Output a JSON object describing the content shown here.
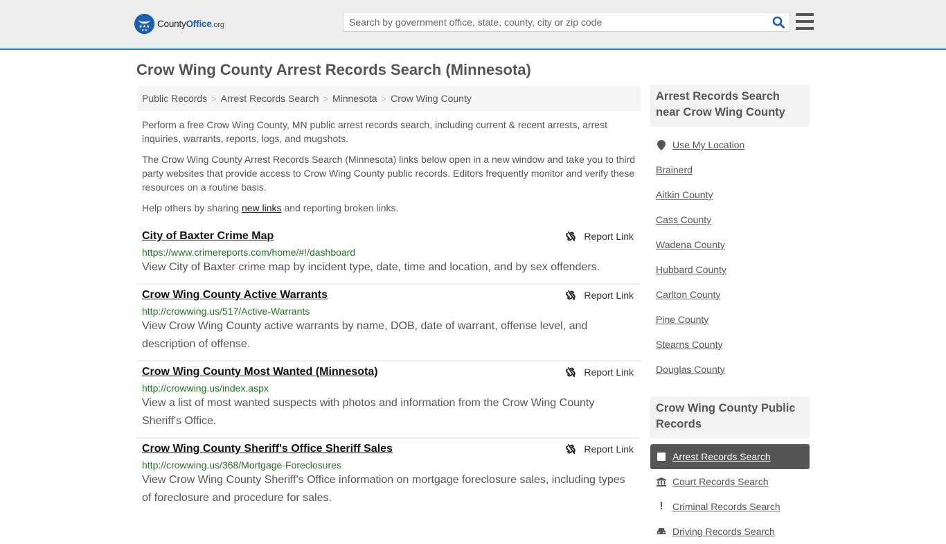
{
  "header": {
    "logo": {
      "name": "County",
      "name_bold": "Office",
      "tld": ".org"
    },
    "search": {
      "placeholder": "Search by government office, state, county, city or zip code",
      "value": ""
    },
    "colors": {
      "accent": "#337ab7",
      "brand": "#1f5ea8"
    }
  },
  "page": {
    "title": "Crow Wing County Arrest Records Search (Minnesota)",
    "breadcrumb": [
      "Public Records",
      "Arrest Records Search",
      "Minnesota",
      "Crow Wing County"
    ],
    "intro": {
      "p1": "Perform a free Crow Wing County, MN public arrest records search, including current & recent arrests, arrest inquiries, warrants, reports, logs, and mugshots.",
      "p2": "The Crow Wing County Arrest Records Search (Minnesota) links below open in a new window and take you to third party websites that provide access to Crow Wing County public records. Editors frequently monitor and verify these resources on a routine basis.",
      "p3_before": "Help others by sharing ",
      "p3_link": "new links",
      "p3_after": " and reporting broken links."
    }
  },
  "results": [
    {
      "title": "City of Baxter Crime Map",
      "url": "https://www.crimereports.com/home/#!/dashboard",
      "description": "View City of Baxter crime map by incident type, date, time and location, and by sex offenders.",
      "report_label": "Report Link"
    },
    {
      "title": "Crow Wing County Active Warrants",
      "url": "http://crowwing.us/517/Active-Warrants",
      "description": "View Crow Wing County active warrants by name, DOB, date of warrant, offense level, and description of offense.",
      "report_label": "Report Link"
    },
    {
      "title": "Crow Wing County Most Wanted (Minnesota)",
      "url": "http://crowwing.us/index.aspx",
      "description": "View a list of most wanted suspects with photos and information from the Crow Wing County Sheriff's Office.",
      "report_label": "Report Link"
    },
    {
      "title": "Crow Wing County Sheriff's Office Sheriff Sales",
      "url": "http://crowwing.us/368/Mortgage-Foreclosures",
      "description": "View Crow Wing County Sheriff's Office information on mortgage foreclosure sales, including types of foreclosure and procedure for sales.",
      "report_label": "Report Link"
    }
  ],
  "sidebar": {
    "nearby": {
      "heading": "Arrest Records Search near Crow Wing County",
      "use_location": "Use My Location",
      "items": [
        "Brainerd",
        "Aitkin County",
        "Cass County",
        "Wadena County",
        "Hubbard County",
        "Carlton County",
        "Pine County",
        "Stearns County",
        "Douglas County"
      ]
    },
    "public_records": {
      "heading": "Crow Wing County Public Records",
      "items": [
        {
          "label": "Arrest Records Search",
          "icon": "square-icon",
          "active": true
        },
        {
          "label": "Court Records Search",
          "icon": "courthouse-icon",
          "active": false
        },
        {
          "label": "Criminal Records Search",
          "icon": "exclamation-icon",
          "active": false
        },
        {
          "label": "Driving Records Search",
          "icon": "car-icon",
          "active": false
        }
      ]
    }
  }
}
